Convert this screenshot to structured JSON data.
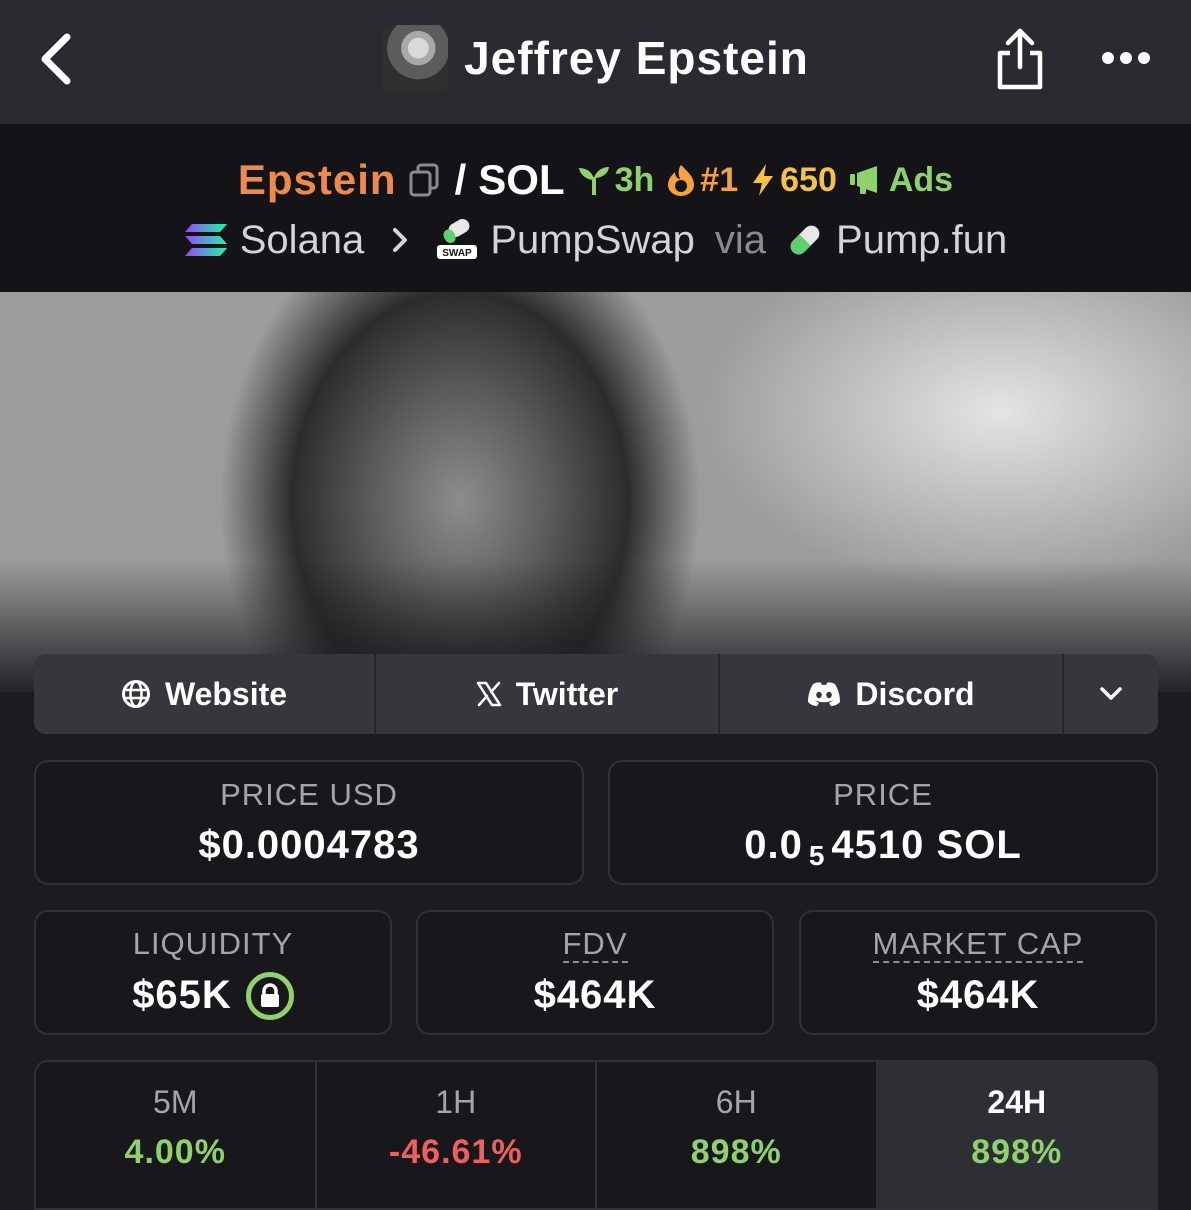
{
  "header": {
    "title": "Jeffrey Epstein"
  },
  "pair": {
    "token": "Epstein",
    "separator": "/",
    "quote": "SOL",
    "age": "3h",
    "rank": "#1",
    "boosts": "650",
    "ads": "Ads"
  },
  "chain": {
    "network": "Solana",
    "dex": "PumpSwap",
    "via": "via",
    "launchpad": "Pump.fun",
    "dex_icon_text": "SWAP"
  },
  "links": {
    "website": "Website",
    "twitter": "Twitter",
    "discord": "Discord"
  },
  "stats": {
    "price_usd_label": "PRICE USD",
    "price_usd": "$0.0004783",
    "price_label": "PRICE",
    "price_native_prefix": "0.0",
    "price_native_zeros": "5",
    "price_native_suffix": "4510 SOL",
    "liquidity_label": "LIQUIDITY",
    "liquidity": "$65K",
    "fdv_label": "FDV",
    "fdv": "$464K",
    "mcap_label": "MARKET CAP",
    "mcap": "$464K"
  },
  "changes": [
    {
      "tf": "5M",
      "pct": "4.00%",
      "color": "#8fd16a"
    },
    {
      "tf": "1H",
      "pct": "-46.61%",
      "color": "#ef5f5f"
    },
    {
      "tf": "6H",
      "pct": "898%",
      "color": "#8fd16a"
    },
    {
      "tf": "24H",
      "pct": "898%",
      "color": "#8fd16a"
    }
  ],
  "colors": {
    "token": "#f08a4b",
    "positive": "#8fd16a",
    "negative": "#ef5f5f",
    "rank": "#f5a23b",
    "boost": "#f5c242"
  }
}
